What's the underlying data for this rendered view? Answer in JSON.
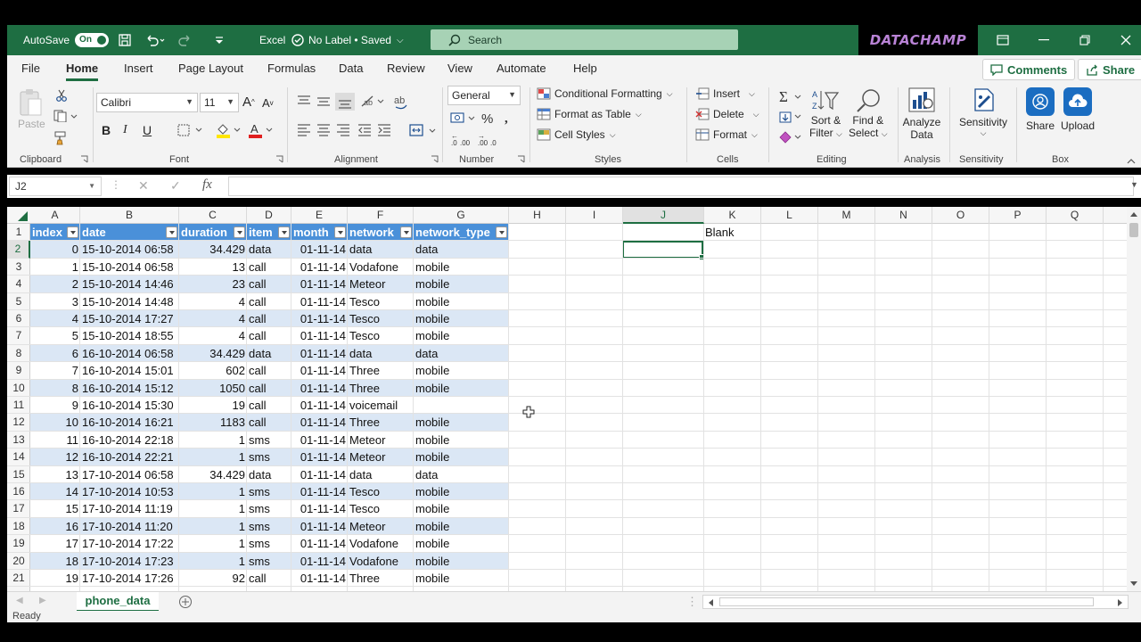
{
  "titlebar": {
    "autosave_label": "AutoSave",
    "autosave_state": "On",
    "file_title": "Excel",
    "label_status": "No Label • Saved",
    "search_placeholder": "Search",
    "brand": "DATACHAMP"
  },
  "menu": {
    "tabs": [
      "File",
      "Home",
      "Insert",
      "Page Layout",
      "Formulas",
      "Data",
      "Review",
      "View",
      "Automate",
      "Help"
    ],
    "comments_label": "Comments",
    "share_label": "Share"
  },
  "ribbon": {
    "clipboard": {
      "paste": "Paste",
      "label": "Clipboard"
    },
    "font": {
      "name": "Calibri",
      "size": "11",
      "label": "Font"
    },
    "alignment": {
      "label": "Alignment"
    },
    "number": {
      "format": "General",
      "label": "Number"
    },
    "styles": {
      "conditional": "Conditional Formatting",
      "format_table": "Format as Table",
      "cell_styles": "Cell Styles",
      "label": "Styles"
    },
    "cells": {
      "insert": "Insert",
      "delete": "Delete",
      "format": "Format",
      "label": "Cells"
    },
    "editing": {
      "sort_1": "Sort &",
      "sort_2": "Filter",
      "find_1": "Find &",
      "find_2": "Select",
      "label": "Editing"
    },
    "analysis": {
      "btn_1": "Analyze",
      "btn_2": "Data",
      "label": "Analysis"
    },
    "sensitivity": {
      "btn": "Sensitivity",
      "label": "Sensitivity"
    },
    "box": {
      "share": "Share",
      "upload": "Upload",
      "label": "Box"
    }
  },
  "formula_bar": {
    "name_box": "J2",
    "fx": "fx",
    "value": ""
  },
  "sheet": {
    "columns": [
      "A",
      "B",
      "C",
      "D",
      "E",
      "F",
      "G",
      "H",
      "I",
      "J",
      "K",
      "L",
      "M",
      "N",
      "O",
      "P",
      "Q"
    ],
    "selected_column": "J",
    "selected_row": "2",
    "rows": [
      "1",
      "2",
      "3",
      "4",
      "5",
      "6",
      "7",
      "8",
      "9",
      "10",
      "11",
      "12",
      "13",
      "14",
      "15",
      "16",
      "17",
      "18",
      "19",
      "20",
      "21"
    ],
    "table_headers": [
      "index",
      "date",
      "duration",
      "item",
      "month",
      "network",
      "network_type"
    ],
    "table_rows": [
      [
        "0",
        "15-10-2014 06:58",
        "34.429",
        "data",
        "01-11-14",
        "data",
        "data"
      ],
      [
        "1",
        "15-10-2014 06:58",
        "13",
        "call",
        "01-11-14",
        "Vodafone",
        "mobile"
      ],
      [
        "2",
        "15-10-2014 14:46",
        "23",
        "call",
        "01-11-14",
        "Meteor",
        "mobile"
      ],
      [
        "3",
        "15-10-2014 14:48",
        "4",
        "call",
        "01-11-14",
        "Tesco",
        "mobile"
      ],
      [
        "4",
        "15-10-2014 17:27",
        "4",
        "call",
        "01-11-14",
        "Tesco",
        "mobile"
      ],
      [
        "5",
        "15-10-2014 18:55",
        "4",
        "call",
        "01-11-14",
        "Tesco",
        "mobile"
      ],
      [
        "6",
        "16-10-2014 06:58",
        "34.429",
        "data",
        "01-11-14",
        "data",
        "data"
      ],
      [
        "7",
        "16-10-2014 15:01",
        "602",
        "call",
        "01-11-14",
        "Three",
        "mobile"
      ],
      [
        "8",
        "16-10-2014 15:12",
        "1050",
        "call",
        "01-11-14",
        "Three",
        "mobile"
      ],
      [
        "9",
        "16-10-2014 15:30",
        "19",
        "call",
        "01-11-14",
        "voicemail",
        ""
      ],
      [
        "10",
        "16-10-2014 16:21",
        "1183",
        "call",
        "01-11-14",
        "Three",
        "mobile"
      ],
      [
        "11",
        "16-10-2014 22:18",
        "1",
        "sms",
        "01-11-14",
        "Meteor",
        "mobile"
      ],
      [
        "12",
        "16-10-2014 22:21",
        "1",
        "sms",
        "01-11-14",
        "Meteor",
        "mobile"
      ],
      [
        "13",
        "17-10-2014 06:58",
        "34.429",
        "data",
        "01-11-14",
        "data",
        "data"
      ],
      [
        "14",
        "17-10-2014 10:53",
        "1",
        "sms",
        "01-11-14",
        "Tesco",
        "mobile"
      ],
      [
        "15",
        "17-10-2014 11:19",
        "1",
        "sms",
        "01-11-14",
        "Tesco",
        "mobile"
      ],
      [
        "16",
        "17-10-2014 11:20",
        "1",
        "sms",
        "01-11-14",
        "Meteor",
        "mobile"
      ],
      [
        "17",
        "17-10-2014 17:22",
        "1",
        "sms",
        "01-11-14",
        "Vodafone",
        "mobile"
      ],
      [
        "18",
        "17-10-2014 17:23",
        "1",
        "sms",
        "01-11-14",
        "Vodafone",
        "mobile"
      ],
      [
        "19",
        "17-10-2014 17:26",
        "92",
        "call",
        "01-11-14",
        "Three",
        "mobile"
      ]
    ],
    "k1_value": "Blank"
  },
  "sheet_tab": "phone_data",
  "status": "Ready",
  "colors": {
    "excel_green": "#1e6e42",
    "table_header": "#4a90d9",
    "table_band": "#dbe7f5"
  }
}
